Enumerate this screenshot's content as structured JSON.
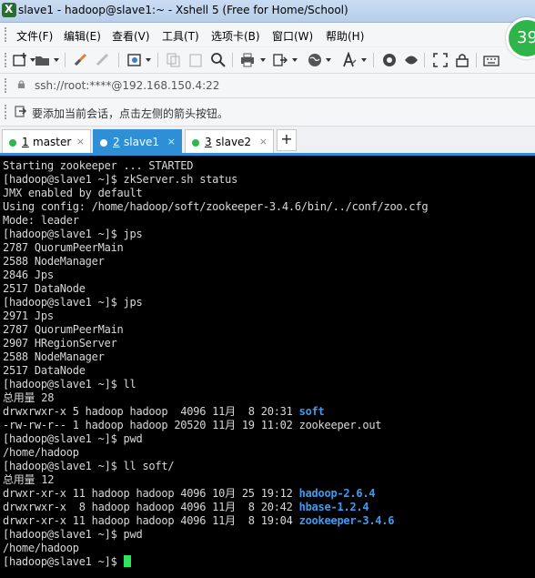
{
  "window": {
    "title": "slave1 - hadoop@slave1:~ - Xshell 5 (Free for Home/School)"
  },
  "menu": {
    "items": [
      "文件(F)",
      "编辑(E)",
      "查看(V)",
      "工具(T)",
      "选项卡(B)",
      "窗口(W)",
      "帮助(H)"
    ]
  },
  "toolbar": {
    "icons": [
      "new-session-icon",
      "open-folder-icon",
      "link-icon",
      "unlink-icon",
      "properties-icon",
      "copy-icon",
      "paste-icon",
      "find-icon",
      "print-icon",
      "transfer-icon",
      "globe-icon",
      "font-icon",
      "xftp-icon",
      "xmanager-icon",
      "fullscreen-icon",
      "lock-icon",
      "keyboard-icon"
    ]
  },
  "address": {
    "text": "ssh://root:****@192.168.150.4:22"
  },
  "hint": {
    "text": "要添加当前会话，点击左侧的箭头按钮。"
  },
  "tabs": [
    {
      "num": "1",
      "label": "master",
      "active": false
    },
    {
      "num": "2",
      "label": "slave1",
      "active": true
    },
    {
      "num": "3",
      "label": "slave2",
      "active": false
    }
  ],
  "tab_add": "+",
  "tab_close": "×",
  "badge": {
    "text": "39"
  },
  "terminal": {
    "lines": [
      {
        "text": "Starting zookeeper ... STARTED"
      },
      {
        "text": "[hadoop@slave1 ~]$ zkServer.sh status"
      },
      {
        "text": "JMX enabled by default"
      },
      {
        "text": "Using config: /home/hadoop/soft/zookeeper-3.4.6/bin/../conf/zoo.cfg"
      },
      {
        "text": "Mode: leader"
      },
      {
        "text": "[hadoop@slave1 ~]$ jps"
      },
      {
        "text": "2787 QuorumPeerMain"
      },
      {
        "text": "2588 NodeManager"
      },
      {
        "text": "2846 Jps"
      },
      {
        "text": "2517 DataNode"
      },
      {
        "text": "[hadoop@slave1 ~]$ jps"
      },
      {
        "text": "2971 Jps"
      },
      {
        "text": "2787 QuorumPeerMain"
      },
      {
        "text": "2907 HRegionServer"
      },
      {
        "text": "2588 NodeManager"
      },
      {
        "text": "2517 DataNode"
      },
      {
        "text": "[hadoop@slave1 ~]$ ll"
      },
      {
        "text": "总用量 28"
      },
      {
        "prefix": "drwxrwxr-x 5 hadoop hadoop  4096 11月  8 20:31 ",
        "dir": "soft"
      },
      {
        "text": "-rw-rw-r-- 1 hadoop hadoop 20520 11月 19 11:02 zookeeper.out"
      },
      {
        "text": "[hadoop@slave1 ~]$ pwd"
      },
      {
        "text": "/home/hadoop"
      },
      {
        "text": "[hadoop@slave1 ~]$ ll soft/"
      },
      {
        "text": "总用量 12"
      },
      {
        "prefix": "drwxr-xr-x 11 hadoop hadoop 4096 10月 25 19:12 ",
        "dir": "hadoop-2.6.4"
      },
      {
        "prefix": "drwxrwxr-x  8 hadoop hadoop 4096 11月  8 20:42 ",
        "dir": "hbase-1.2.4"
      },
      {
        "prefix": "drwxr-xr-x 11 hadoop hadoop 4096 11月  8 19:04 ",
        "dir": "zookeeper-3.4.6"
      },
      {
        "text": "[hadoop@slave1 ~]$ pwd"
      },
      {
        "text": "/home/hadoop"
      },
      {
        "text": "[hadoop@slave1 ~]$ ",
        "cursor": true
      }
    ]
  }
}
